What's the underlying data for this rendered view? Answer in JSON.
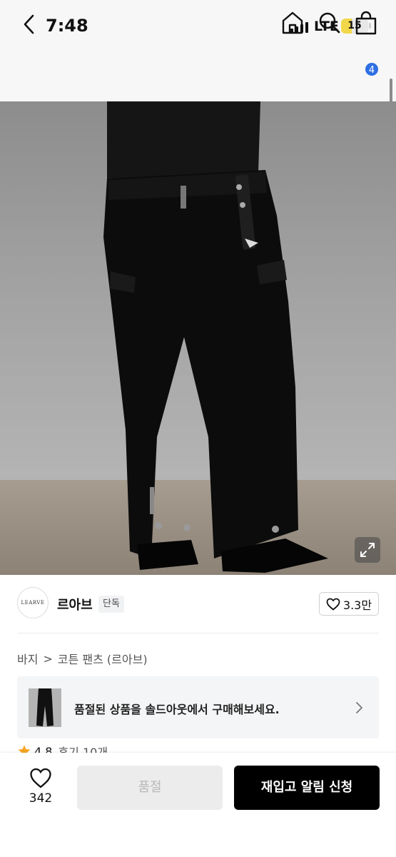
{
  "status_bar": {
    "time": "7:48",
    "network": "LTE",
    "battery": "15"
  },
  "nav": {
    "cart_count": "4",
    "icons": [
      "back-icon",
      "home-icon",
      "search-icon",
      "cart-icon"
    ]
  },
  "product_image": {
    "alt": "black cargo pants"
  },
  "brand": {
    "logo_text": "LEARVE",
    "name": "르아브",
    "badge": "단독",
    "like_count": "3.3만"
  },
  "breadcrumb": {
    "category": "바지",
    "separator": ">",
    "product": "코튼 팬츠 (르아브)"
  },
  "soldout_banner": {
    "text": "품절된 상품을 솔드아웃에서 구매해보세요."
  },
  "rating": {
    "score": "4.8",
    "reviews": "후기 10개"
  },
  "bottom_bar": {
    "wish_count": "342",
    "soldout_label": "품절",
    "restock_label": "재입고 알림 신청"
  },
  "colors": {
    "accent": "#2f6fe4",
    "primary_button": "#000000",
    "disabled_button": "#ececec",
    "rating_star": "#f5a623"
  }
}
